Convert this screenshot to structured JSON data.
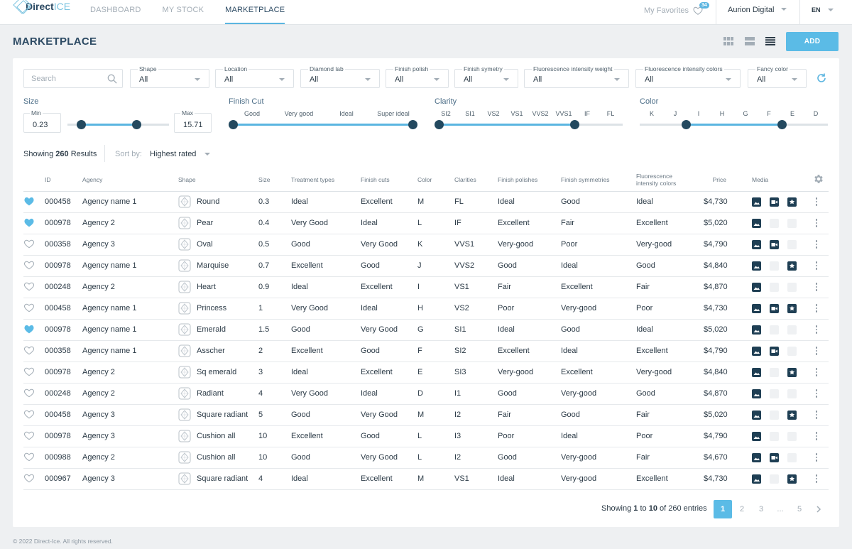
{
  "brand": {
    "name_bold": "Direct",
    "name_light": "ICE"
  },
  "nav": [
    {
      "label": "DASHBOARD"
    },
    {
      "label": "MY STOCK"
    },
    {
      "label": "MARKETPLACE"
    }
  ],
  "favorites": {
    "label": "My Favorites",
    "count": "34"
  },
  "user": {
    "name": "Aurion Digital"
  },
  "lang": "EN",
  "page": {
    "title": "MARKETPLACE",
    "add_label": "ADD"
  },
  "search": {
    "placeholder": "Search"
  },
  "filters": [
    {
      "label": "Shape",
      "value": "All"
    },
    {
      "label": "Location",
      "value": "All"
    },
    {
      "label": "Diamond lab",
      "value": "All"
    },
    {
      "label": "Finish polish",
      "value": "All"
    },
    {
      "label": "Finish symetry",
      "value": "All"
    },
    {
      "label": "Fluorescence intensity weight",
      "value": "All"
    },
    {
      "label": "Fluorescence intensity colors",
      "value": "All"
    },
    {
      "label": "Fancy color",
      "value": "All"
    }
  ],
  "size": {
    "label": "Size",
    "min_label": "Min",
    "min": "0.23",
    "max_label": "Max",
    "max": "15.71"
  },
  "finish_cut": {
    "label": "Finish Cut",
    "ticks": [
      "Good",
      "Very good",
      "Ideal",
      "Super ideal"
    ]
  },
  "clarity": {
    "label": "Clarity",
    "ticks": [
      "SI2",
      "SI1",
      "VS2",
      "VS1",
      "VVS2",
      "VVS1",
      "IF",
      "FL"
    ]
  },
  "color": {
    "label": "Color",
    "ticks": [
      "K",
      "J",
      "I",
      "H",
      "G",
      "F",
      "E",
      "D"
    ]
  },
  "results": {
    "prefix": "Showing",
    "count": "260",
    "suffix": "Results",
    "sort_label": "Sort by:",
    "sort_value": "Highest rated"
  },
  "columns": [
    "ID",
    "Agency",
    "Shape",
    "Size",
    "Treatment types",
    "Finish cuts",
    "Color",
    "Clarities",
    "Finish polishes",
    "Finish symmetries",
    "Fluorescence intensity colors",
    "Price",
    "Media"
  ],
  "rows": [
    {
      "fav": true,
      "id": "000458",
      "agency": "Agency name 1",
      "shape": "Round",
      "size": "0.3",
      "treatment": "Ideal",
      "cut": "Excellent",
      "color": "M",
      "clarity": "FL",
      "polish": "Ideal",
      "symmetry": "Good",
      "fluor": "Ideal",
      "price": "$4,730",
      "media": [
        1,
        1,
        1
      ]
    },
    {
      "fav": true,
      "id": "000978",
      "agency": "Agency 2",
      "shape": "Pear",
      "size": "0.4",
      "treatment": "Very Good",
      "cut": "Ideal",
      "color": "L",
      "clarity": "IF",
      "polish": "Excellent",
      "symmetry": "Fair",
      "fluor": "Excellent",
      "price": "$5,020",
      "media": [
        1,
        0,
        0
      ]
    },
    {
      "fav": false,
      "id": "000358",
      "agency": "Agency 3",
      "shape": "Oval",
      "size": "0.5",
      "treatment": "Good",
      "cut": "Very Good",
      "color": "K",
      "clarity": "VVS1",
      "polish": "Very-good",
      "symmetry": "Poor",
      "fluor": "Very-good",
      "price": "$4,790",
      "media": [
        1,
        1,
        0
      ]
    },
    {
      "fav": false,
      "id": "000978",
      "agency": "Agency name 1",
      "shape": "Marquise",
      "size": "0.7",
      "treatment": "Excellent",
      "cut": "Good",
      "color": "J",
      "clarity": "VVS2",
      "polish": "Good",
      "symmetry": "Ideal",
      "fluor": "Good",
      "price": "$4,840",
      "media": [
        1,
        0,
        1
      ]
    },
    {
      "fav": false,
      "id": "000248",
      "agency": "Agency 2",
      "shape": "Heart",
      "size": "0.9",
      "treatment": "Ideal",
      "cut": "Excellent",
      "color": "I",
      "clarity": "VS1",
      "polish": "Fair",
      "symmetry": "Excellent",
      "fluor": "Fair",
      "price": "$4,870",
      "media": [
        1,
        0,
        0
      ]
    },
    {
      "fav": false,
      "id": "000458",
      "agency": "Agency name 1",
      "shape": "Princess",
      "size": "1",
      "treatment": "Very Good",
      "cut": "Ideal",
      "color": "H",
      "clarity": "VS2",
      "polish": "Poor",
      "symmetry": "Very-good",
      "fluor": "Poor",
      "price": "$4,730",
      "media": [
        1,
        1,
        1
      ]
    },
    {
      "fav": true,
      "id": "000978",
      "agency": "Agency name 1",
      "shape": "Emerald",
      "size": "1.5",
      "treatment": "Good",
      "cut": "Very Good",
      "color": "G",
      "clarity": "SI1",
      "polish": "Ideal",
      "symmetry": "Good",
      "fluor": "Ideal",
      "price": "$5,020",
      "media": [
        1,
        0,
        0
      ]
    },
    {
      "fav": false,
      "id": "000358",
      "agency": "Agency name 1",
      "shape": "Asscher",
      "size": "2",
      "treatment": "Excellent",
      "cut": "Good",
      "color": "F",
      "clarity": "SI2",
      "polish": "Excellent",
      "symmetry": "Ideal",
      "fluor": "Excellent",
      "price": "$4,790",
      "media": [
        1,
        1,
        0
      ]
    },
    {
      "fav": false,
      "id": "000978",
      "agency": "Agency 2",
      "shape": "Sq emerald",
      "size": "3",
      "treatment": "Ideal",
      "cut": "Excellent",
      "color": "E",
      "clarity": "SI3",
      "polish": "Very-good",
      "symmetry": "Excellent",
      "fluor": "Very-good",
      "price": "$4,840",
      "media": [
        1,
        0,
        1
      ]
    },
    {
      "fav": false,
      "id": "000248",
      "agency": "Agency 2",
      "shape": "Radiant",
      "size": "4",
      "treatment": "Very Good",
      "cut": "Ideal",
      "color": "D",
      "clarity": "I1",
      "polish": "Good",
      "symmetry": "Very-good",
      "fluor": "Good",
      "price": "$4,870",
      "media": [
        1,
        0,
        0
      ]
    },
    {
      "fav": false,
      "id": "000458",
      "agency": "Agency 3",
      "shape": "Square radiant",
      "size": "5",
      "treatment": "Good",
      "cut": "Very Good",
      "color": "M",
      "clarity": "I2",
      "polish": "Fair",
      "symmetry": "Good",
      "fluor": "Fair",
      "price": "$5,020",
      "media": [
        1,
        0,
        1
      ]
    },
    {
      "fav": false,
      "id": "000978",
      "agency": "Agency 3",
      "shape": "Cushion all",
      "size": "10",
      "treatment": "Excellent",
      "cut": "Good",
      "color": "L",
      "clarity": "I3",
      "polish": "Poor",
      "symmetry": "Ideal",
      "fluor": "Poor",
      "price": "$4,790",
      "media": [
        1,
        0,
        0
      ]
    },
    {
      "fav": false,
      "id": "000988",
      "agency": "Agency 2",
      "shape": "Cushion all",
      "size": "10",
      "treatment": "Good",
      "cut": "Very Good",
      "color": "L",
      "clarity": "I2",
      "polish": "Good",
      "symmetry": "Very-good",
      "fluor": "Fair",
      "price": "$4,670",
      "media": [
        1,
        1,
        0
      ]
    },
    {
      "fav": false,
      "id": "000967",
      "agency": "Agency 3",
      "shape": "Square radiant",
      "size": "4",
      "treatment": "Ideal",
      "cut": "Excellent",
      "color": "M",
      "clarity": "VS1",
      "polish": "Ideal",
      "symmetry": "Very-good",
      "fluor": "Excellent",
      "price": "$4,730",
      "media": [
        1,
        0,
        1
      ]
    }
  ],
  "pagination": {
    "prefix": "Showing",
    "from": "1",
    "to_word": "to",
    "to": "10",
    "of_word": "of 260 entries",
    "pages": [
      "1",
      "2",
      "3",
      "...",
      "5"
    ]
  },
  "footer": "© 2022 Direct-Ice. All rights reserved.",
  "colors": {
    "accent": "#5bbbe6",
    "dark": "#1f3f54",
    "title": "#2c4a63"
  }
}
